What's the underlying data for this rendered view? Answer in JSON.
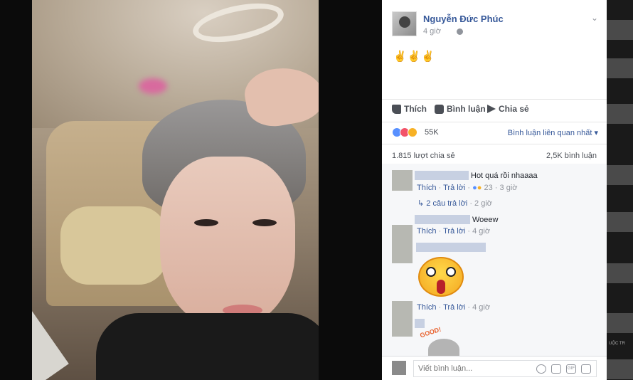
{
  "post": {
    "author": "Nguyễn Đức Phúc",
    "time": "4 giờ",
    "text": "✌✌✌",
    "actions": {
      "like": "Thích",
      "comment": "Bình luận",
      "share": "Chia sẻ"
    },
    "reaction_count": "55K",
    "sort_label": "Bình luận liên quan nhất",
    "share_count": "1.815 lượt chia sẻ",
    "comment_count": "2,5K bình luận"
  },
  "comments": [
    {
      "text": "Hot quá rồi nhaaaa",
      "like": "Thích",
      "reply": "Trả lời",
      "reactions": "23",
      "time": "3 giờ",
      "replies": "2 câu trả lời",
      "replies_time": "2 giờ"
    },
    {
      "text": "Woeew",
      "like": "Thích",
      "reply": "Trả lời",
      "time": "4 giờ"
    },
    {
      "like": "Thích",
      "reply": "Trả lời",
      "time": "4 giờ",
      "sticker_text": "GOOD!"
    }
  ],
  "comment_box": {
    "placeholder": "Viết bình luận...",
    "icons": [
      "emoji-icon",
      "camera-icon",
      "gif-icon",
      "sticker-icon"
    ],
    "gif_label": "GIF"
  },
  "right_strip": {
    "label": "UỘC TR"
  },
  "colors": {
    "link": "#365899",
    "meta": "#90949c",
    "like": "#5890ff",
    "love": "#f25268",
    "wow": "#f7b125"
  }
}
